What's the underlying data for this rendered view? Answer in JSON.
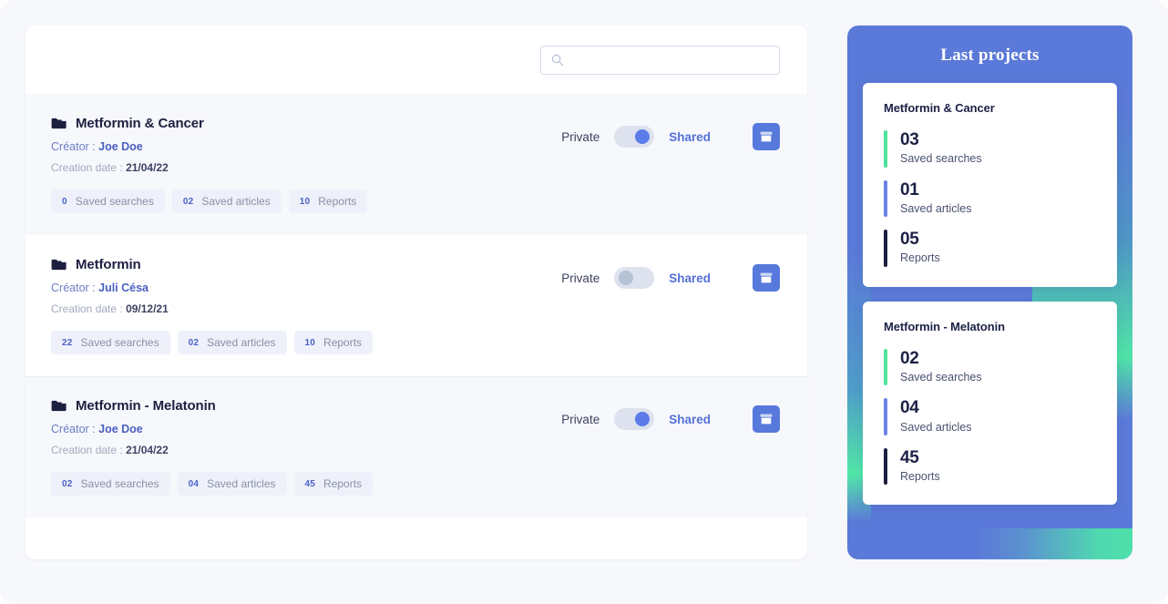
{
  "colors": {
    "accent_blue": "#5779dc",
    "shared_blue": "#5570d8",
    "creator_blue": "#4a5fc1",
    "page_bg": "#f7f8fc",
    "row_shaded": "#f6f8fc",
    "sidebar_blue": "#5b79d8",
    "green": "#4fe3a6",
    "stat_green": "#4ee39b",
    "stat_blue": "#6b85e6",
    "stat_dark": "#1d1f3f"
  },
  "search": {
    "icon": "search-icon",
    "value": "",
    "placeholder": ""
  },
  "projects": [
    {
      "title": "Metformin & Cancer",
      "icon": "folder-icon",
      "creator_label": "Créator :",
      "creator_name": "Joe Doe",
      "date_label": "Creation date :",
      "date_value": "21/04/22",
      "pills": [
        {
          "count": "0",
          "label": "Saved searches"
        },
        {
          "count": "02",
          "label": "Saved articles"
        },
        {
          "count": "10",
          "label": "Reports"
        }
      ],
      "private_label": "Private",
      "shared_label": "Shared",
      "shared_on": true,
      "archive_icon": "archive-box-icon"
    },
    {
      "title": "Metformin",
      "icon": "folder-icon",
      "creator_label": "Créator :",
      "creator_name": "Juli Césa",
      "date_label": "Creation date :",
      "date_value": "09/12/21",
      "pills": [
        {
          "count": "22",
          "label": "Saved searches"
        },
        {
          "count": "02",
          "label": "Saved articles"
        },
        {
          "count": "10",
          "label": "Reports"
        }
      ],
      "private_label": "Private",
      "shared_label": "Shared",
      "shared_on": false,
      "archive_icon": "archive-box-icon"
    },
    {
      "title": "Metformin - Melatonin",
      "icon": "folder-icon",
      "creator_label": "Créator :",
      "creator_name": "Joe Doe",
      "date_label": "Creation date :",
      "date_value": "21/04/22",
      "pills": [
        {
          "count": "02",
          "label": "Saved searches"
        },
        {
          "count": "04",
          "label": "Saved articles"
        },
        {
          "count": "45",
          "label": "Reports"
        }
      ],
      "private_label": "Private",
      "shared_label": "Shared",
      "shared_on": true,
      "archive_icon": "archive-box-icon"
    }
  ],
  "sidebar": {
    "title": "Last projects",
    "cards": [
      {
        "title": "Metformin & Cancer",
        "stats": [
          {
            "value": "03",
            "label": "Saved searches",
            "color": "#4ee39b"
          },
          {
            "value": "01",
            "label": "Saved articles",
            "color": "#6b85e6"
          },
          {
            "value": "05",
            "label": "Reports",
            "color": "#1d1f3f"
          }
        ]
      },
      {
        "title": "Metformin - Melatonin",
        "stats": [
          {
            "value": "02",
            "label": "Saved searches",
            "color": "#4ee39b"
          },
          {
            "value": "04",
            "label": "Saved articles",
            "color": "#6b85e6"
          },
          {
            "value": "45",
            "label": "Reports",
            "color": "#1d1f3f"
          }
        ]
      }
    ]
  }
}
